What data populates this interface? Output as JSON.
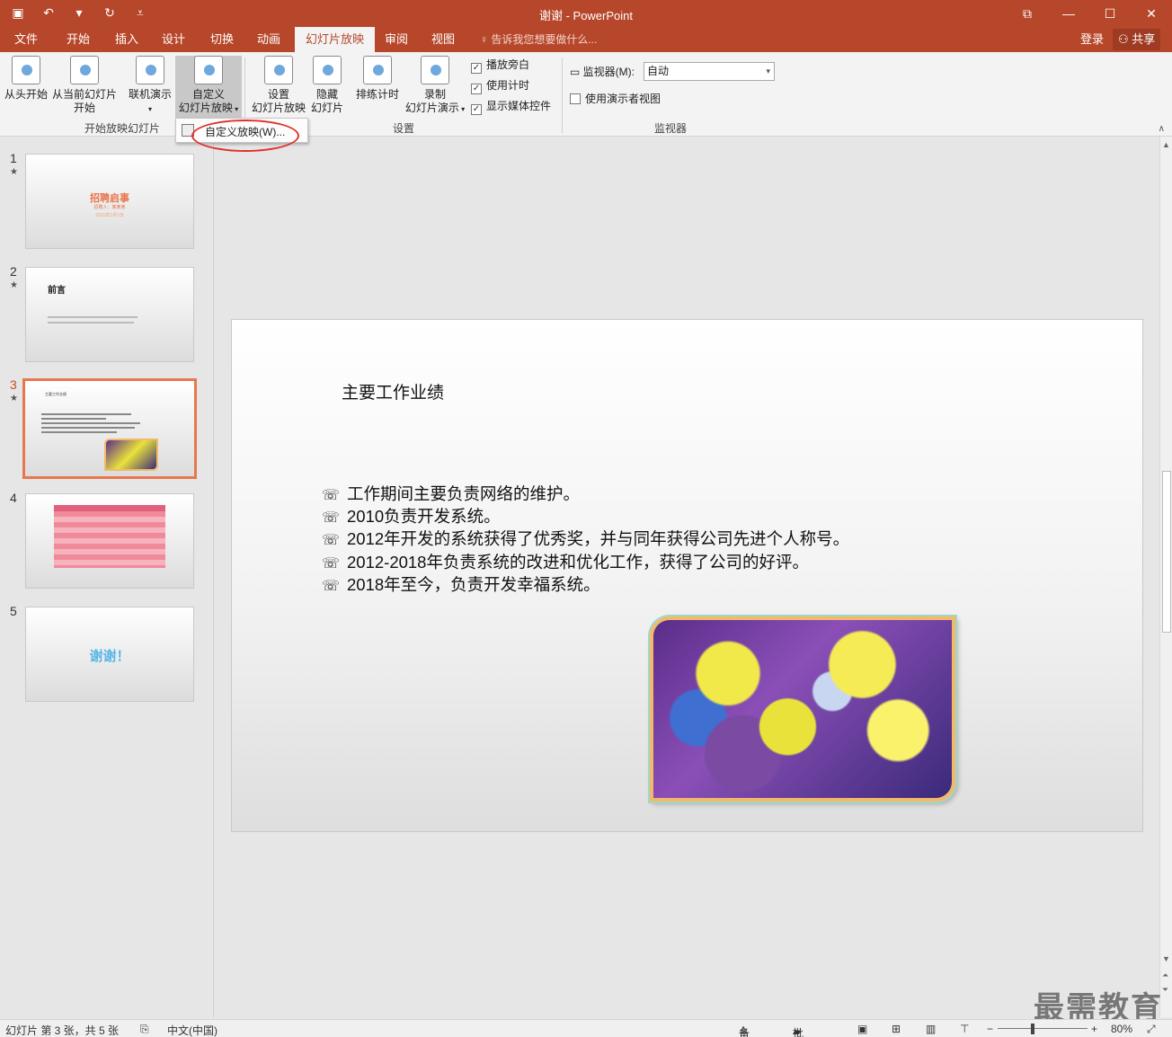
{
  "window": {
    "title": "谢谢 - PowerPoint",
    "qat": [
      {
        "icon": "save-icon",
        "glyph": "▣"
      },
      {
        "icon": "undo-icon",
        "glyph": "↶"
      },
      {
        "icon": "undo-dropdown-icon",
        "glyph": "▾"
      },
      {
        "icon": "redo-icon",
        "glyph": "↻"
      },
      {
        "icon": "customize-qat-icon",
        "glyph": "⩡"
      }
    ],
    "controls": [
      "⧉",
      "—",
      "☐",
      "✕"
    ]
  },
  "tabs": [
    "文件",
    "开始",
    "插入",
    "设计",
    "切换",
    "动画",
    "幻灯片放映",
    "审阅",
    "视图"
  ],
  "active_tab": "幻灯片放映",
  "tell_me": "告诉我您想要做什么...",
  "login": "登录",
  "share": "共享",
  "ribbon": {
    "groups": {
      "start": "开始放映幻灯片",
      "setup": "设置",
      "monitors": "监视器"
    },
    "buttons": {
      "from_beginning": "从头开始",
      "from_current_1": "从当前幻灯片",
      "from_current_2": "开始",
      "present_online": "联机演示",
      "custom_1": "自定义",
      "custom_2": "幻灯片放映",
      "setup_1": "设置",
      "setup_2": "幻灯片放映",
      "hide_1": "隐藏",
      "hide_2": "幻灯片",
      "rehearse": "排练计时",
      "record_1": "录制",
      "record_2": "幻灯片演示"
    },
    "checks": {
      "narration": "播放旁白",
      "timings": "使用计时",
      "media_controls": "显示媒体控件"
    },
    "monitor_label": "监视器(M):",
    "monitor_value": "自动",
    "presenter_view": "使用演示者视图"
  },
  "dropdown_item": "自定义放映(W)...",
  "slides": [
    {
      "num": "1",
      "star": "★",
      "title": "招聘启事",
      "sub1": "招聘人：某某某",
      "sub2": "2021年1月1日"
    },
    {
      "num": "2",
      "star": "★",
      "title": "前言"
    },
    {
      "num": "3",
      "star": "★",
      "title": "主要工作业绩"
    },
    {
      "num": "4",
      "star": ""
    },
    {
      "num": "5",
      "star": "",
      "title": "谢谢！"
    }
  ],
  "current_slide": {
    "title": "主要工作业绩",
    "bullet_mark": "☏",
    "bullets": [
      "工作期间主要负责网络的维护。",
      "2010负责开发系统。",
      "2012年开发的系统获得了优秀奖，并与同年获得公司先进个人称号。",
      "2012-2018年负责系统的改进和优化工作，获得了公司的好评。",
      "2018年至今，负责开发幸福系统。"
    ]
  },
  "status": {
    "slide_info": "幻灯片 第 3 张，共 5 张",
    "language": "中文(中国)",
    "notes": "备注",
    "comments": "批注",
    "zoom": "80%"
  },
  "watermark": "最需教育"
}
